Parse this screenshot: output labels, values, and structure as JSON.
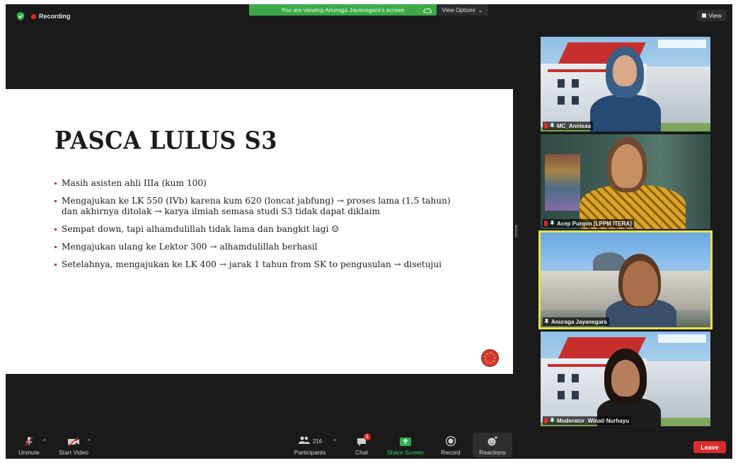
{
  "meeting": {
    "recording_label": "Recording",
    "viewing_banner": "You are viewing Anuraga Jayanegara's screen",
    "view_options_label": "View Options",
    "view_button_label": "View",
    "shield_icon": "shield-check-icon",
    "accent_green": "#3ca949",
    "recording_red": "#e02a2a"
  },
  "slide": {
    "title": "PASCA LULUS S3",
    "bullets": [
      "Masih asisten ahli IIIa (kum 100)",
      "Mengajukan ke LK 550 (IVb) karena kum 620 (loncat jabfung) → proses lama (1,5 tahun) dan akhirnya ditolak → karya ilmiah semasa studi S3 tidak dapat diklaim",
      "Sempat down, tapi alhamdulillah tidak lama dan bangkit lagi ☺",
      "Mengajukan ulang ke Lektor 300 → alhamdulillah berhasil",
      "Setelahnya, mengajukan ke LK 400 → jarak 1 tahun from SK to pengusulan → disetujui"
    ]
  },
  "participants_tiles": [
    {
      "name": "MC_Annisaa",
      "muted": true
    },
    {
      "name": "Acep Purqon [LPPM ITERA]",
      "muted": true
    },
    {
      "name": "Anuraga Jayanegara",
      "muted": false,
      "active_speaker": true
    },
    {
      "name": "Moderator_Winati Nurhayu",
      "muted": true
    }
  ],
  "toolbar": {
    "unmute_label": "Unmute",
    "start_video_label": "Start Video",
    "participants_label": "Participants",
    "participants_count": "216",
    "chat_label": "Chat",
    "chat_badge": "1",
    "share_screen_label": "Share Screen",
    "record_label": "Record",
    "reactions_label": "Reactions",
    "leave_label": "Leave"
  }
}
